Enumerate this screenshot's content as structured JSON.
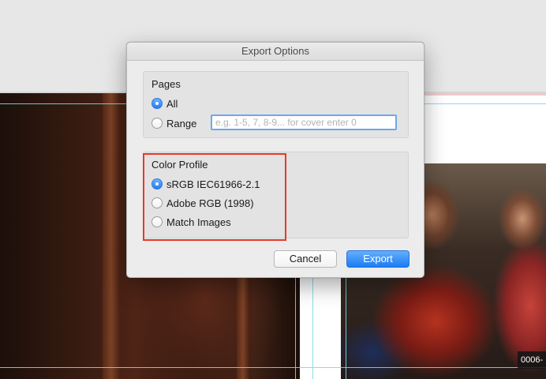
{
  "dialog": {
    "title": "Export Options",
    "pages": {
      "group_label": "Pages",
      "options": [
        {
          "label": "All",
          "selected": true
        },
        {
          "label": "Range",
          "selected": false
        }
      ],
      "range_placeholder": "e.g. 1-5, 7, 8-9... for cover enter 0",
      "range_value": ""
    },
    "color_profile": {
      "group_label": "Color Profile",
      "options": [
        {
          "label": "sRGB IEC61966-2.1",
          "selected": true
        },
        {
          "label": "Adobe RGB (1998)",
          "selected": false
        },
        {
          "label": "Match Images",
          "selected": false
        }
      ]
    },
    "buttons": {
      "cancel": "Cancel",
      "export": "Export"
    }
  },
  "background": {
    "page_label": "0006-"
  },
  "colors": {
    "accent": "#1f7ef5",
    "highlight": "#e8382a",
    "guide": "#7fd7e6"
  }
}
